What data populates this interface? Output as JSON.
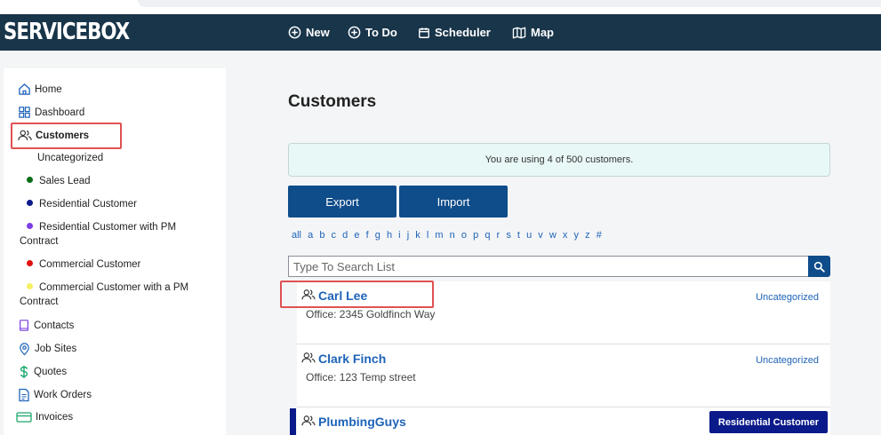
{
  "app": {
    "logo": "SERVICEBOX"
  },
  "topnav": [
    {
      "label": "New",
      "icon": "plus-circle-icon"
    },
    {
      "label": "To Do",
      "icon": "plus-circle-icon"
    },
    {
      "label": "Scheduler",
      "icon": "calendar-icon"
    },
    {
      "label": "Map",
      "icon": "map-icon"
    }
  ],
  "sidebar": {
    "items": [
      {
        "label": "Home",
        "icon": "home-icon"
      },
      {
        "label": "Dashboard",
        "icon": "dashboard-icon"
      },
      {
        "label": "Customers",
        "icon": "users-icon",
        "active": true
      },
      {
        "label": "Contacts",
        "icon": "book-icon"
      },
      {
        "label": "Job Sites",
        "icon": "location-pin-icon"
      },
      {
        "label": "Quotes",
        "icon": "dollar-icon"
      },
      {
        "label": "Work Orders",
        "icon": "document-icon"
      },
      {
        "label": "Invoices",
        "icon": "credit-card-icon"
      }
    ],
    "customer_categories": [
      {
        "label": "Uncategorized",
        "color": ""
      },
      {
        "label": "Sales Lead",
        "color": "#0a6e16"
      },
      {
        "label": "Residential Customer",
        "color": "#0b1a8a"
      },
      {
        "label": "Residential Customer with PM Contract",
        "color": "#7b3fe4"
      },
      {
        "label": "Commercial Customer",
        "color": "#e01010"
      },
      {
        "label": "Commercial Customer with a PM Contract",
        "color": "#f5f060"
      }
    ]
  },
  "main": {
    "title": "Customers",
    "notice": "You are using 4 of 500 customers.",
    "export_label": "Export",
    "import_label": "Import",
    "alphabet": [
      "all",
      "a",
      "b",
      "c",
      "d",
      "e",
      "f",
      "g",
      "h",
      "i",
      "j",
      "k",
      "l",
      "m",
      "n",
      "o",
      "p",
      "q",
      "r",
      "s",
      "t",
      "u",
      "v",
      "w",
      "x",
      "y",
      "z",
      "#"
    ],
    "search_placeholder": "Type To Search List",
    "customers": [
      {
        "name": "Carl Lee",
        "office": "Office: 2345 Goldfinch Way",
        "category": "Uncategorized"
      },
      {
        "name": "Clark Finch",
        "office": "Office: 123 Temp street",
        "category": "Uncategorized"
      },
      {
        "name": "PlumbingGuys",
        "office": "",
        "category": "Residential Customer"
      }
    ]
  },
  "colors": {
    "topbar": "#18354a",
    "button": "#0f4c8a",
    "link": "#1e63b8",
    "highlight_box": "#e05252"
  }
}
